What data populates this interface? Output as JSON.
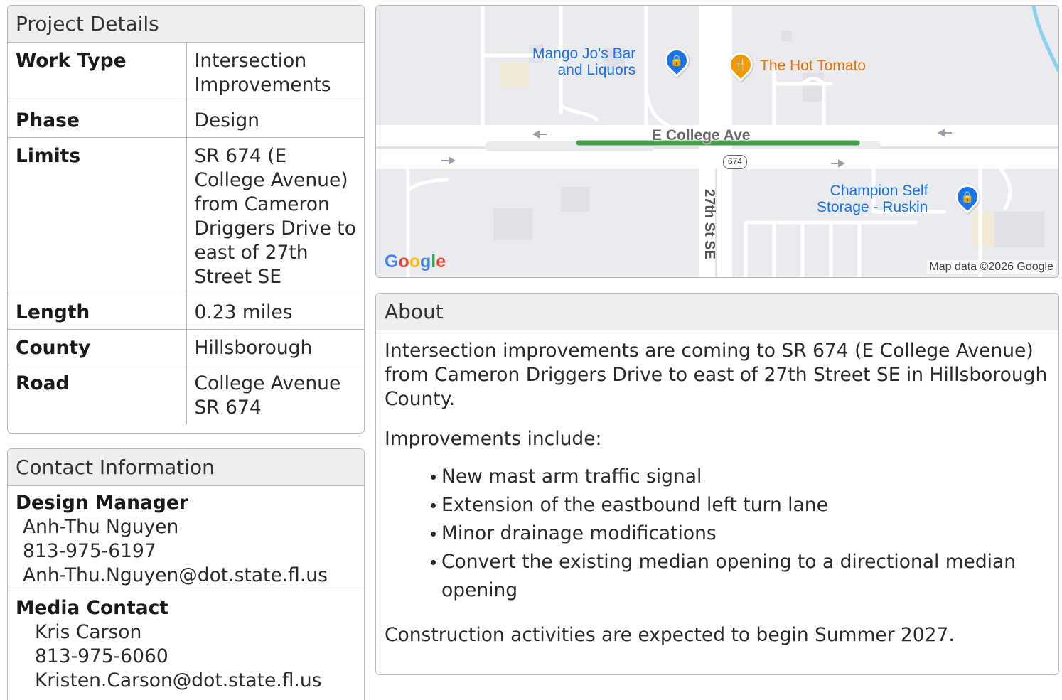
{
  "project_details": {
    "title": "Project Details",
    "rows": [
      {
        "label": "Work Type",
        "value": "Intersection Improvements"
      },
      {
        "label": "Phase",
        "value": "Design"
      },
      {
        "label": "Limits",
        "value": "SR 674 (E College Avenue) from Cameron Driggers Drive to east of 27th Street SE"
      },
      {
        "label": "Length",
        "value": "0.23 miles"
      },
      {
        "label": "County",
        "value": "Hillsborough"
      },
      {
        "label": "Road",
        "value": "College Avenue SR 674"
      }
    ]
  },
  "contact": {
    "title": "Contact Information",
    "design_manager": {
      "role": "Design Manager",
      "name": "Anh-Thu Nguyen",
      "phone": "813-975-6197",
      "email": "Anh-Thu.Nguyen@dot.state.fl.us"
    },
    "media_contact": {
      "role": "Media Contact",
      "name": "Kris Carson",
      "phone": "813-975-6060",
      "email": "Kristen.Carson@dot.state.fl.us"
    }
  },
  "map": {
    "pois": [
      {
        "name": "Mango Jo's Bar and Liquors",
        "line1": "Mango Jo's Bar",
        "line2": "and Liquors",
        "icon": "shopping-bag-icon",
        "color": "#1a73e8"
      },
      {
        "name": "The Hot Tomato",
        "icon": "restaurant-icon",
        "color": "#e8710a"
      },
      {
        "name": "Champion Self Storage - Ruskin",
        "line1": "Champion Self",
        "line2": "Storage - Ruskin",
        "icon": "shopping-bag-icon",
        "color": "#1a73e8"
      }
    ],
    "road_label": "E College Ave",
    "route_shield": "674",
    "cross_street": "27th St SE",
    "logo": "Google",
    "attribution": "Map data ©2026 Google",
    "highlight_color": "#43a047"
  },
  "about": {
    "title": "About",
    "intro": "Intersection improvements are coming to SR 674 (E College Avenue) from Cameron Driggers Drive to east of 27th Street SE in Hillsborough County.",
    "list_heading": "Improvements include:",
    "items": [
      "New mast arm traffic signal",
      "Extension of the eastbound left turn lane",
      "Minor drainage modifications",
      "Convert the existing median opening to a directional median opening"
    ],
    "closing": "Construction activities are expected to begin Summer 2027."
  }
}
